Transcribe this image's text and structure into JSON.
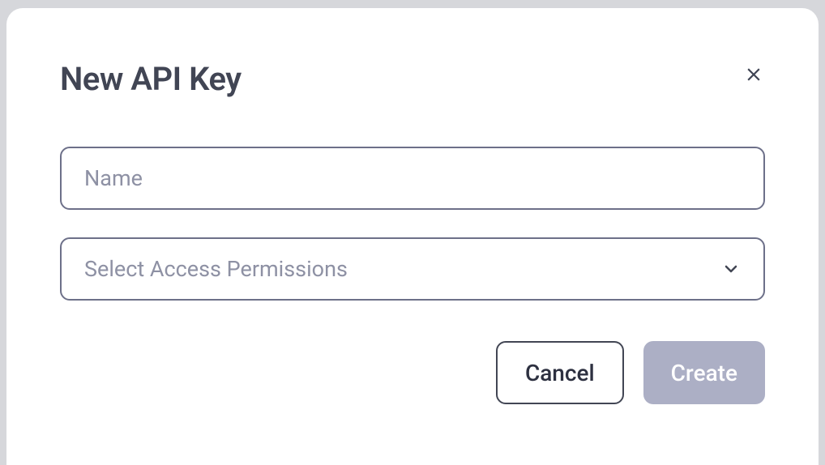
{
  "modal": {
    "title": "New API Key",
    "name_input": {
      "placeholder": "Name",
      "value": ""
    },
    "permissions_select": {
      "placeholder": "Select Access Permissions"
    },
    "buttons": {
      "cancel": "Cancel",
      "create": "Create"
    }
  }
}
